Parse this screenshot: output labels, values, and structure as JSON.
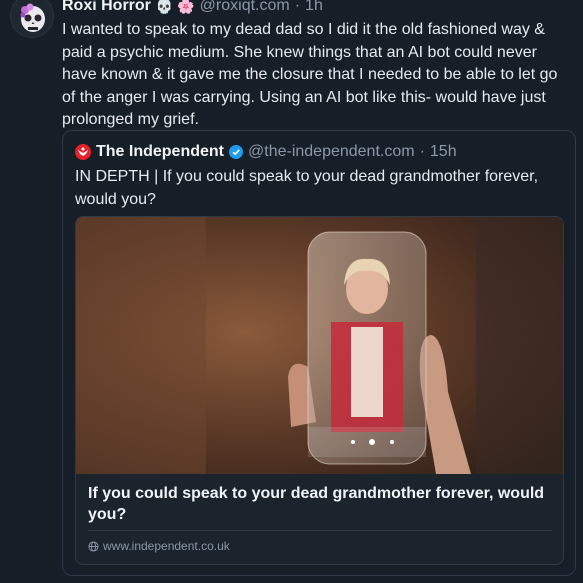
{
  "post": {
    "author_name": "Roxi Horror",
    "author_emojis": "💀 🌸",
    "handle": "@roxiqt.com",
    "separator": "·",
    "time": "1h",
    "text": "I wanted to speak to my dead dad so I did it the old fashioned way & paid a psychic medium. She knew things that an AI bot could never have known & it gave me the closure that I needed to be able to let go of the anger I was carrying. Using an AI bot like this- would have just prolonged my grief."
  },
  "quote": {
    "author_name": "The Independent",
    "handle": "@the-independent.com",
    "separator": "·",
    "time": "15h",
    "text": "IN DEPTH | If you could speak to your dead grandmother forever, would you?",
    "card": {
      "title": "If you could speak to your dead grandmother forever, would you?",
      "domain": "www.independent.co.uk"
    }
  },
  "colors": {
    "background": "#161e28",
    "border": "#2e3a48",
    "muted_text": "#8b98a5",
    "verified_blue": "#1d9bf0",
    "independent_red": "#e8202a"
  }
}
